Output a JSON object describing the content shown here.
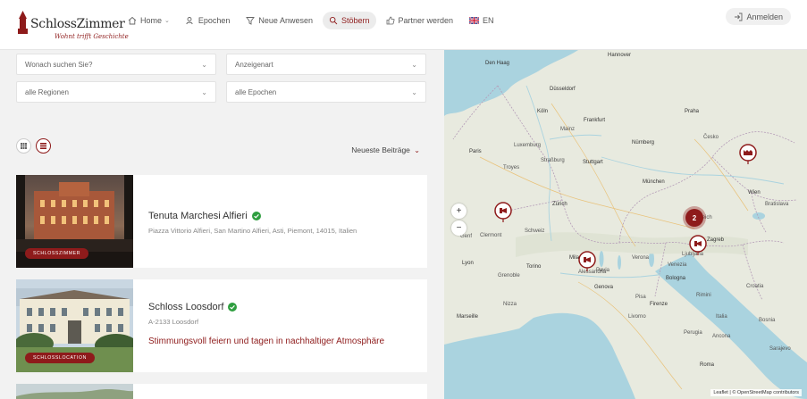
{
  "header": {
    "brand": "SchlossZimmer",
    "tagline": "Wohnt trifft Geschichte",
    "nav": [
      {
        "label": "Home",
        "icon": "home-icon",
        "has_caret": true
      },
      {
        "label": "Epochen",
        "icon": "users-icon"
      },
      {
        "label": "Neue Anwesen",
        "icon": "filter-icon"
      },
      {
        "label": "Stöbern",
        "icon": "search-icon",
        "active": true
      },
      {
        "label": "Partner werden",
        "icon": "thumbs-up-icon"
      },
      {
        "label": "EN",
        "icon": "uk-flag-icon"
      }
    ],
    "login_label": "Anmelden"
  },
  "filters": {
    "search_placeholder": "Wonach suchen Sie?",
    "ad_type": "Anzeigenart",
    "region": "alle Regionen",
    "epoch": "alle Epochen"
  },
  "toolbar": {
    "sort_label": "Neueste Beiträge",
    "views": [
      "grid-view",
      "list-view"
    ],
    "active_view": "list-view"
  },
  "listings": [
    {
      "title": "Tenuta Marchesi Alfieri",
      "verified": true,
      "address": "Piazza Vittorio Alfieri, San Martino Alfieri, Asti, Piemont, 14015, Italien",
      "badge": "SCHLOSSZIMMER"
    },
    {
      "title": "Schloss Loosdorf",
      "verified": true,
      "address": "A-2133 Loosdorf",
      "claim": "Stimmungsvoll feiern und tagen in nachhaltiger Atmosphäre",
      "badge": "SCHLOSSLOCATION"
    }
  ],
  "map": {
    "labels": [
      "Hannover",
      "Den Haag",
      "Düsseldorf",
      "Köln",
      "Luxemburg",
      "Frankfurt",
      "Mainz",
      "Nürnberg",
      "Paris",
      "Straßburg",
      "Stuttgart",
      "München",
      "Troyes",
      "Praha",
      "Česko",
      "Wien",
      "Bratislava",
      "Zürich",
      "Genf",
      "Lyon",
      "Schweiz",
      "Österreich",
      "Ljubljana",
      "Zagreb",
      "Torino",
      "Milano",
      "Genova",
      "Bologna",
      "Firenze",
      "Nizza",
      "Marseille",
      "Roma",
      "Italia",
      "Croatia",
      "Verona",
      "Venezia",
      "Grenoble",
      "Clermont",
      "Pavia",
      "Alessandria",
      "Sarajevo",
      "Ancona",
      "Perugia",
      "Livorno",
      "Pisa",
      "Rimini",
      "Bosnia"
    ],
    "cluster_count": "2",
    "zoom_in": "+",
    "zoom_out": "−",
    "attribution_leaflet": "Leaflet",
    "attribution_osm": "© OpenStreetMap contributors",
    "accent": "#8e1b1b",
    "land": "#e8eadf",
    "sea": "#aad3df"
  }
}
